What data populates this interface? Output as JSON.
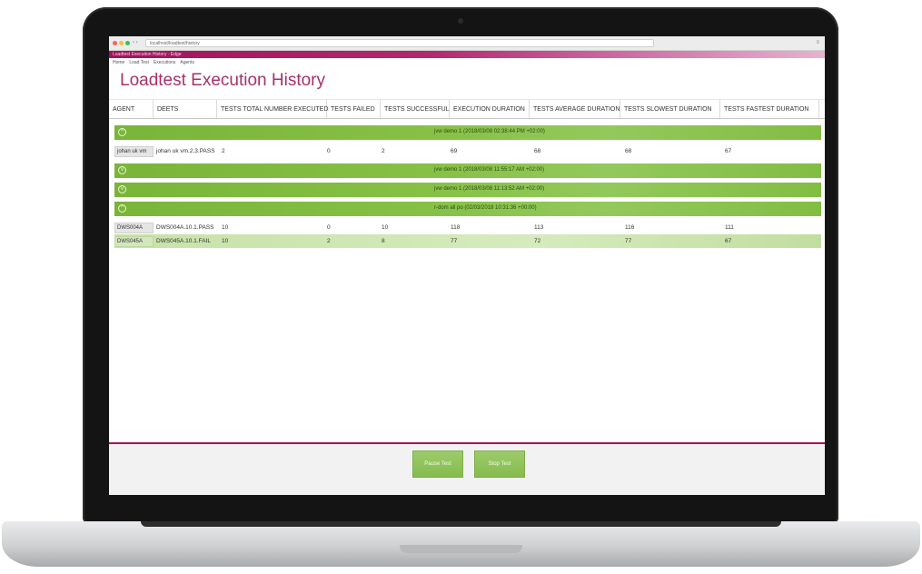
{
  "browser": {
    "url": "localhost/loadtest/history",
    "tab_title": "Loadtest Execution History - Edge",
    "controls": "‹ ›"
  },
  "app": {
    "header_text": "Loadtest Execution History - Edge",
    "menu": [
      "Home",
      "Load Test",
      "Executions",
      "Agents"
    ]
  },
  "page_title": "Loadtest Execution History",
  "columns": [
    "AGENT",
    "DEETS",
    "TESTS TOTAL NUMBER EXECUTED",
    "TESTS FAILED",
    "TESTS SUCCESSFUL",
    "EXECUTION DURATION",
    "TESTS AVERAGE DURATION",
    "TESTS SLOWEST DURATION",
    "TESTS FASTEST DURATION"
  ],
  "groups": [
    {
      "label": "jvw demo 1 (2018/03/08 02:38:44 PM +02:00)",
      "toggle": "^",
      "rows": [
        {
          "agent": "johan uk vm",
          "deets": "johan uk vm.2.3.PASS",
          "total": "2",
          "failed": "0",
          "successful": "2",
          "execution": "69",
          "average": "68",
          "slowest": "68",
          "fastest": "67"
        }
      ]
    },
    {
      "label": "jvw demo 1 (2018/03/08 11:55:17 AM +02:00)",
      "toggle": "v",
      "rows": []
    },
    {
      "label": "jvw demo 1 (2018/03/08 11:13:52 AM +02:00)",
      "toggle": "v",
      "rows": []
    },
    {
      "label": "r-dom all po (02/03/2018 10:31:36 +00:00)",
      "toggle": "^",
      "rows": [
        {
          "agent": "DWS004A",
          "deets": "DWS004A.10.1.PASS",
          "total": "10",
          "failed": "0",
          "successful": "10",
          "execution": "118",
          "average": "113",
          "slowest": "116",
          "fastest": "111"
        },
        {
          "agent": "DWS045A",
          "deets": "DWS045A.10.1.FAIL",
          "total": "10",
          "failed": "2",
          "successful": "8",
          "execution": "77",
          "average": "72",
          "slowest": "77",
          "fastest": "67"
        }
      ]
    }
  ],
  "footer": {
    "pause_label": "Pause Test",
    "stop_label": "Stop Test"
  },
  "colors": {
    "brand": "#a1145b",
    "title": "#a8306a",
    "group_green": "#82bd43",
    "row_tint": "#cfe8b4"
  }
}
